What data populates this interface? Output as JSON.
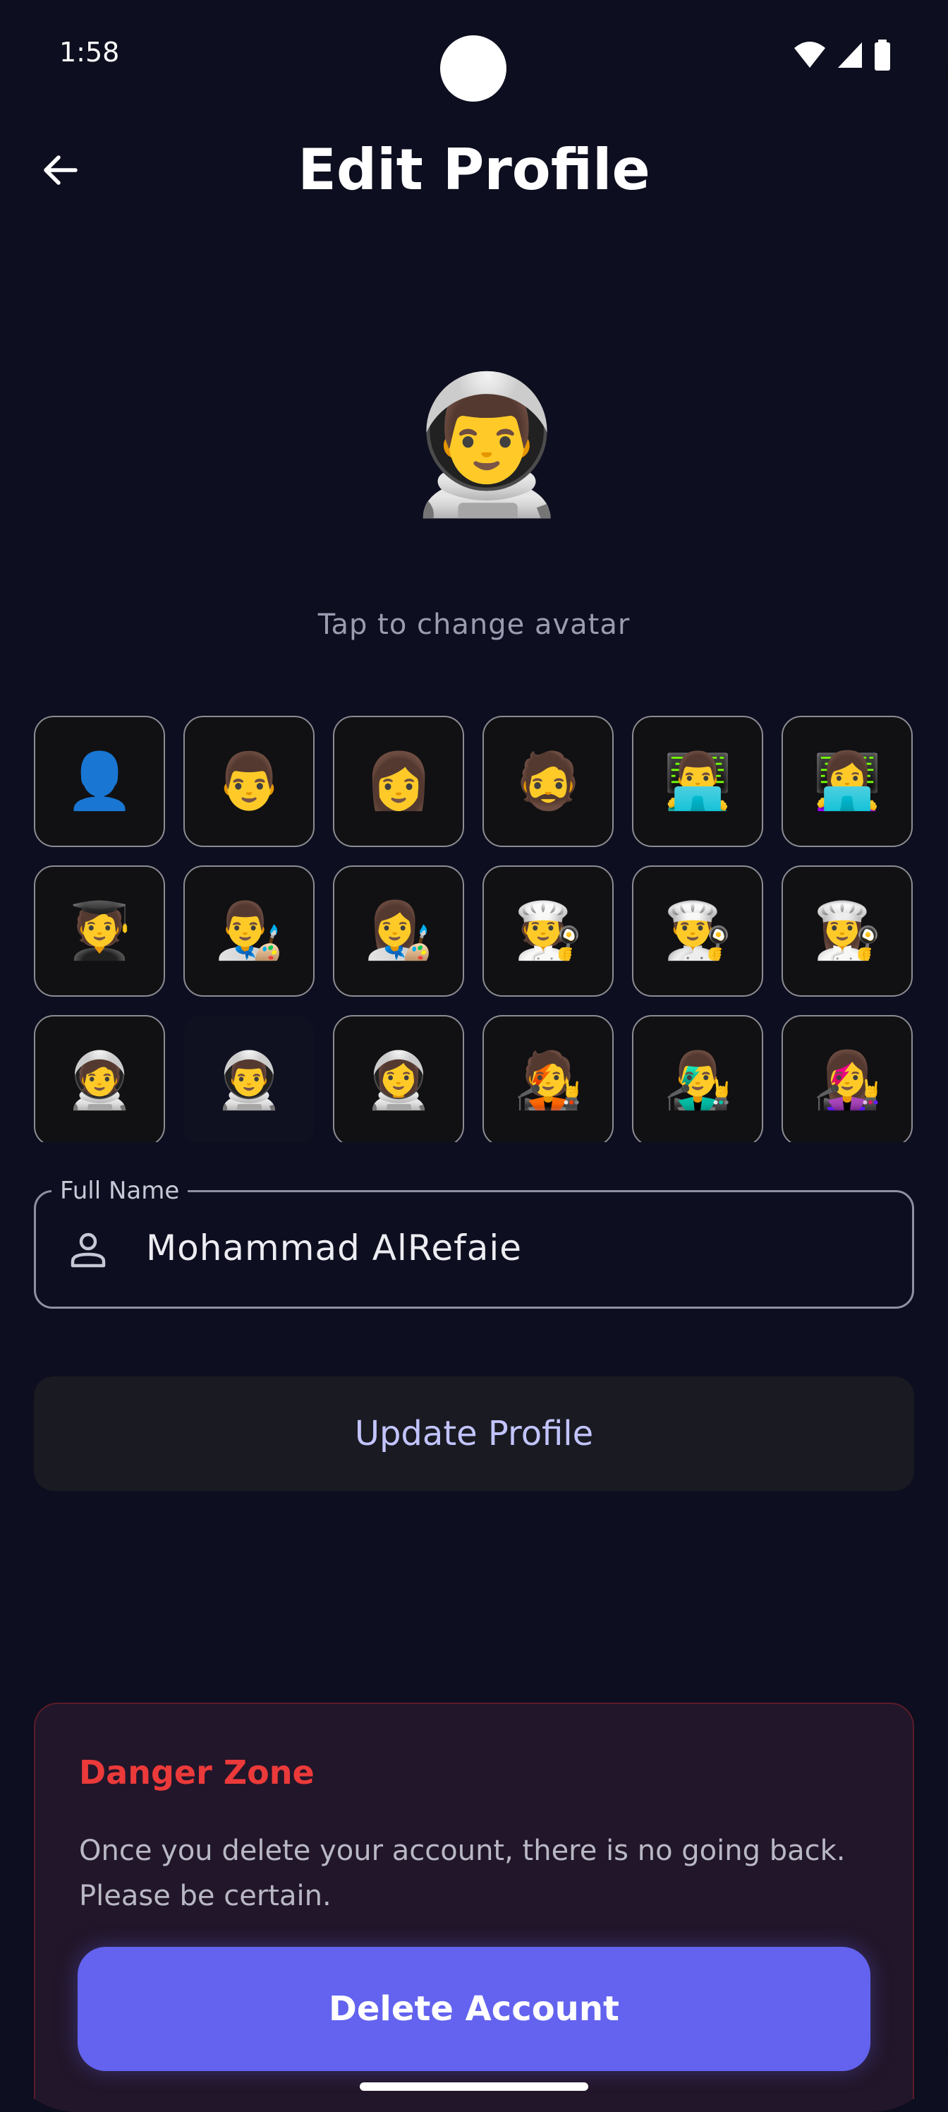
{
  "status_bar": {
    "time": "1:58",
    "icons": [
      "wifi-icon",
      "signal-icon",
      "battery-icon"
    ]
  },
  "header": {
    "title": "Edit Profile",
    "back_icon": "arrow-left-icon"
  },
  "avatar": {
    "current": "👨‍🚀",
    "hint": "Tap to change avatar"
  },
  "avatar_options": [
    "👤",
    "👨",
    "👩",
    "🧔",
    "👨‍💻",
    "👩‍💻",
    "🧑‍🎓",
    "👨‍🎨",
    "👩‍🎨",
    "🧑‍🍳",
    "👨‍🍳",
    "👩‍🍳",
    "🧑‍🚀",
    "👨‍🚀",
    "👩‍🚀",
    "🧑‍🎤",
    "👨‍🎤",
    "👩‍🎤"
  ],
  "selected_avatar": "👨‍🚀",
  "name_field": {
    "label": "Full Name",
    "value": "Mohammad AlRefaie",
    "icon": "person-icon"
  },
  "update_button": {
    "label": "Update Profile"
  },
  "danger_zone": {
    "title": "Danger Zone",
    "description": "Once you delete your account, there is no going back. Please be certain.",
    "delete_label": "Delete Account"
  },
  "colors": {
    "background": "#0d0e1f",
    "accent": "#6363ef",
    "danger": "#ec3a3a",
    "update_text": "#c3c4ff"
  }
}
